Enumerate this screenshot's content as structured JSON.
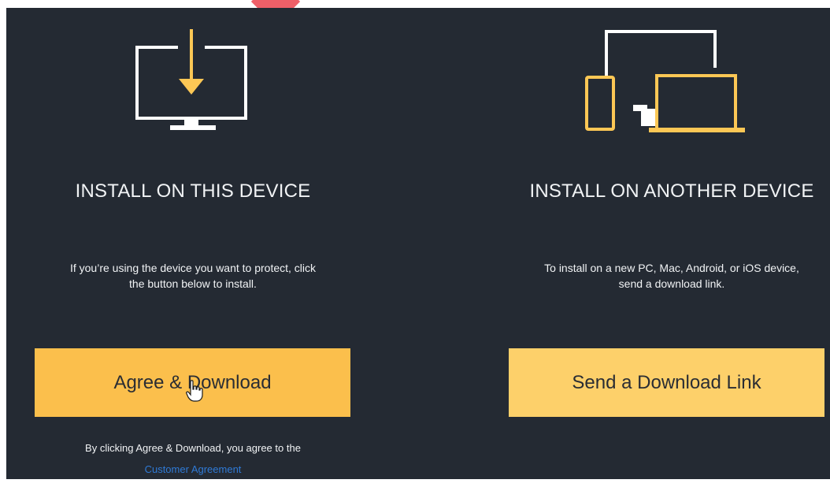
{
  "left": {
    "heading": "INSTALL ON THIS DEVICE",
    "description_line1": "If you’re using the device you want to protect, click",
    "description_line2": "the button below to install.",
    "button_label": "Agree & Download",
    "agreement_text": "By clicking Agree & Download, you agree to the",
    "agreement_link": "Customer Agreement",
    "icon": "monitor-download-icon"
  },
  "right": {
    "heading": "INSTALL ON ANOTHER DEVICE",
    "description_line1": "To install on a new PC, Mac, Android, or iOS device,",
    "description_line2": "send a download link.",
    "button_label": "Send a Download Link",
    "icon": "multi-device-icon"
  },
  "colors": {
    "background": "#242a33",
    "accent": "#fcc755",
    "link": "#2f7ad6",
    "pointer": "#ef5f68"
  }
}
